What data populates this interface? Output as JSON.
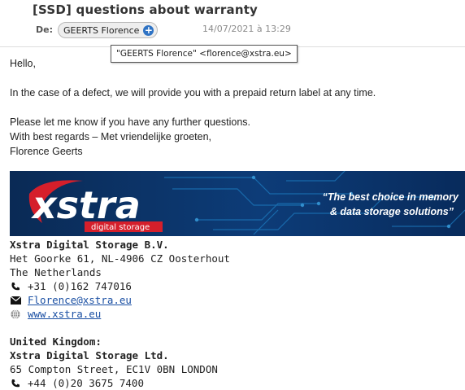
{
  "email": {
    "subject": "[SSD] questions about warranty",
    "from_label": "De:",
    "sender_name": "GEERTS Florence",
    "date": "14/07/2021 à 13:29",
    "tooltip": "\"GEERTS Florence\" <florence@xstra.eu>"
  },
  "body": {
    "greeting": "Hello,",
    "paragraph1": "In the case of a defect, we will provide you with a prepaid return label at any time.",
    "line1": "Please let me know if you have any further questions.",
    "line2": "With best regards – Met vriendelijke groeten,",
    "line3": "Florence Geerts"
  },
  "banner": {
    "logo_text": "xstra",
    "logo_sub": "digital storage",
    "tagline1": "“The best choice in memory",
    "tagline2": "& data storage solutions”",
    "colors": {
      "background": "#0b2e5e",
      "accent": "#d51f2b",
      "circuit": "#1e7fc4"
    }
  },
  "signature": {
    "company": "Xstra Digital Storage B.V.",
    "address1": "Het Goorke 61, NL-4906 CZ Oosterhout",
    "country": "The Netherlands",
    "phone": "+31 (0)162 747016",
    "email": "Florence@xstra.eu",
    "website": "www.xstra.eu",
    "uk_heading": "United Kingdom:",
    "uk_company": "Xstra Digital Storage Ltd.",
    "uk_address": "65 Compton Street, EC1V 0BN LONDON",
    "uk_phone": "+44 (0)20 3675 7400"
  },
  "icons": {
    "phone": "phone-icon",
    "mail": "envelope-icon",
    "web": "globe-icon",
    "add_contact": "plus-circle-icon"
  }
}
